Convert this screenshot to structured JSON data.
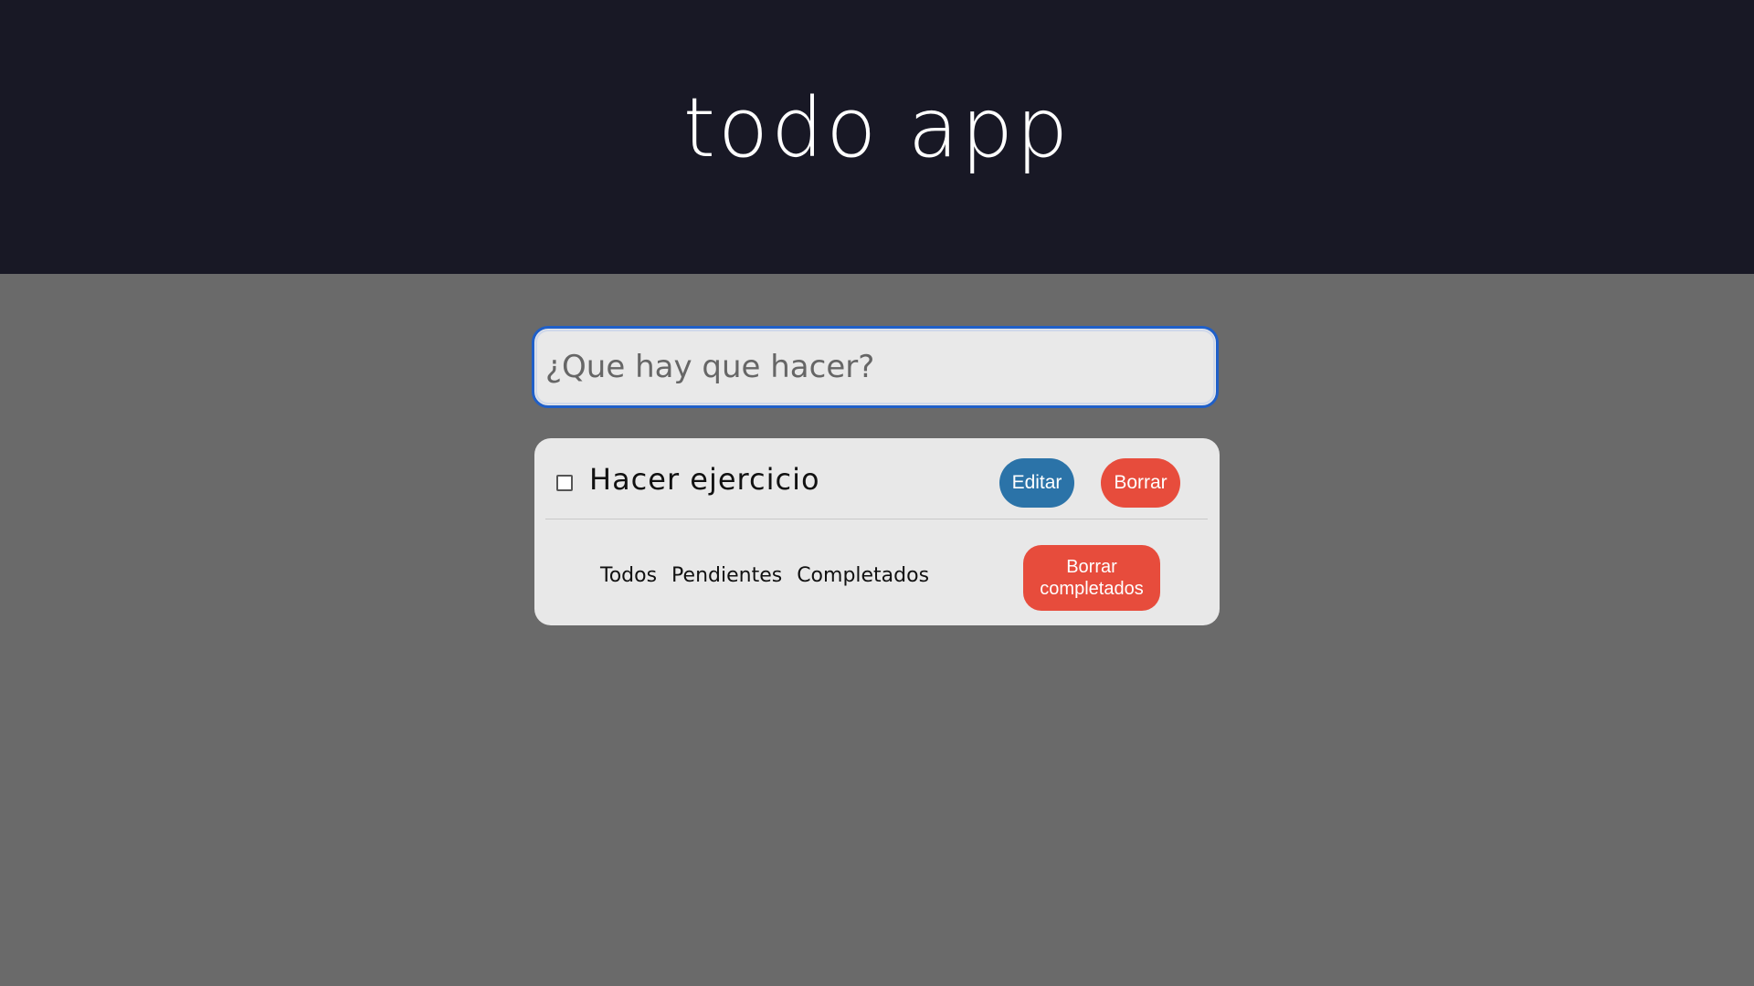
{
  "header": {
    "title": "todo app"
  },
  "new_todo": {
    "placeholder": "¿Que hay que hacer?",
    "value": ""
  },
  "todos": [
    {
      "text": "Hacer ejercicio",
      "completed": false,
      "edit_label": "Editar",
      "delete_label": "Borrar"
    }
  ],
  "filters": {
    "all": "Todos",
    "pending": "Pendientes",
    "completed": "Completados"
  },
  "clear_completed_label": "Borrar completados",
  "colors": {
    "header_bg": "#181825",
    "page_bg": "#6a6a6a",
    "card_bg": "#e8e8e8",
    "edit_button": "#2b73a8",
    "delete_button": "#e74c3c",
    "input_focus_border": "#1f5fc8"
  }
}
